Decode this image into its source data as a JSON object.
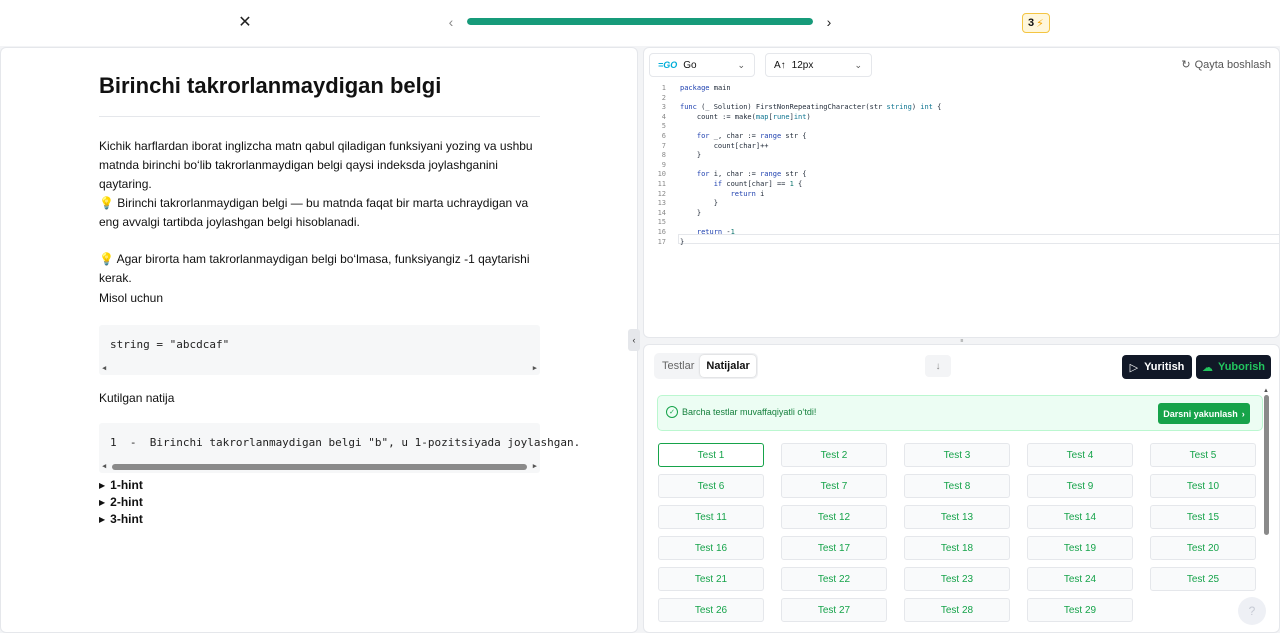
{
  "topbar": {
    "progress_fraction": 1.0,
    "streak_count": "3"
  },
  "problem": {
    "title": "Birinchi takrorlanmaydigan belgi",
    "paragraph1": "Kichik harflardan iborat inglizcha matn qabul qiladigan funksiyani yozing va ushbu matnda birinchi bo‘lib takrorlanmaydigan belgi qaysi indeksda joylashganini qaytaring.",
    "paragraph2": "Birinchi takrorlanmaydigan belgi — bu matnda faqat bir marta uchraydigan va eng avvalgi tartibda joylashgan belgi hisoblanadi.",
    "paragraph3": "Agar birorta ham takrorlanmaydigan belgi bo‘lmasa, funksiyangiz -1 qaytarishi kerak.",
    "example_heading": "Misol uchun",
    "example_code": "string = \"abcdcaf\"",
    "expected_heading": "Kutilgan natija",
    "expected_code": "1  -  Birinchi takrorlanmaydigan belgi \"b\", u 1-pozitsiyada joylashgan.",
    "hints": [
      "1-hint",
      "2-hint",
      "3-hint"
    ]
  },
  "editor": {
    "language": "Go",
    "font_size": "12px",
    "restart_label": "Qayta boshlash",
    "lines": [
      "package main",
      "",
      "func (_ Solution) FirstNonRepeatingCharacter(str string) int {",
      "    count := make(map[rune]int)",
      "",
      "    for _, char := range str {",
      "        count[char]++",
      "    }",
      "",
      "    for i, char := range str {",
      "        if count[char] == 1 {",
      "            return i",
      "        }",
      "    }",
      "",
      "    return -1",
      "}"
    ]
  },
  "results": {
    "tabs": [
      "Testlar",
      "Natijalar"
    ],
    "run_label": "Yuritish",
    "submit_label": "Yuborish",
    "success_message": "Barcha testlar muvaffaqiyatli o‘tdi!",
    "finish_label": "Darsni yakunlash",
    "tests": [
      "Test 1",
      "Test 2",
      "Test 3",
      "Test 4",
      "Test 5",
      "Test 6",
      "Test 7",
      "Test 8",
      "Test 9",
      "Test 10",
      "Test 11",
      "Test 12",
      "Test 13",
      "Test 14",
      "Test 15",
      "Test 16",
      "Test 17",
      "Test 18",
      "Test 19",
      "Test 20",
      "Test 21",
      "Test 22",
      "Test 23",
      "Test 24",
      "Test 25",
      "Test 26",
      "Test 27",
      "Test 28",
      "Test 29"
    ]
  },
  "colors": {
    "accent_green": "#16a34a",
    "progress": "#169b7a",
    "dark_button": "#111827"
  }
}
